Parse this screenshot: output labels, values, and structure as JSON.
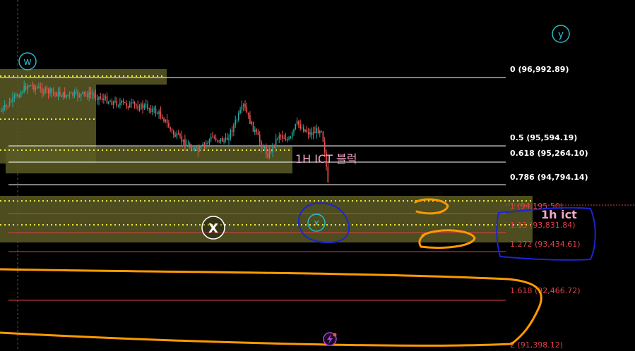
{
  "chart_data": {
    "type": "candlestick",
    "colors": {
      "background": "#000000",
      "up": "#26a69a",
      "down": "#ef5350",
      "zone": "#5a5a24",
      "zone_dots": "#e8e840",
      "fib_white": "#ffffff",
      "fib_red": "#e0404a",
      "wave_teal": "#2bb8c8",
      "marker_orange": "#ff9a00",
      "marker_blue": "#1a26d0",
      "note_pink": "#f4a8c8"
    },
    "fib_levels": [
      {
        "ratio": "0",
        "price": "96,992.89",
        "label": "0 (96,992.89)",
        "color": "white"
      },
      {
        "ratio": "0.5",
        "price": "95,594.19",
        "label": "0.5 (95,594.19)",
        "color": "white"
      },
      {
        "ratio": "0.618",
        "price": "95,264.10",
        "label": "0.618 (95,264.10)",
        "color": "white"
      },
      {
        "ratio": "0.786",
        "price": "94,794.14",
        "label": "0.786 (94,794.14)",
        "color": "white"
      },
      {
        "ratio": "1",
        "price": "94,195.50",
        "label": "1 (94,195.50)",
        "color": "red"
      },
      {
        "ratio": "1.13",
        "price": "93,831.84",
        "label": "1.13 (93,831.84)",
        "color": "red"
      },
      {
        "ratio": "1.272",
        "price": "93,434.61",
        "label": "1.272 (93,434.61)",
        "color": "red"
      },
      {
        "ratio": "1.618",
        "price": "92,466.72",
        "label": "1.618 (92,466.72)",
        "color": "red"
      },
      {
        "ratio": "2",
        "price": "91,398.12",
        "label": "2 (91,398.12)",
        "color": "red"
      }
    ],
    "wave_labels": {
      "w": "w",
      "x_circle": "X",
      "x_small": "x",
      "y": "y"
    },
    "annotations": {
      "ict_block": "1H ICT 블럭",
      "handwritten_note": "1h ict"
    },
    "price_series_description": "1H candles declining from ~96,800 to ~94,000 with sharp wick to ~93,800",
    "grid": false
  }
}
